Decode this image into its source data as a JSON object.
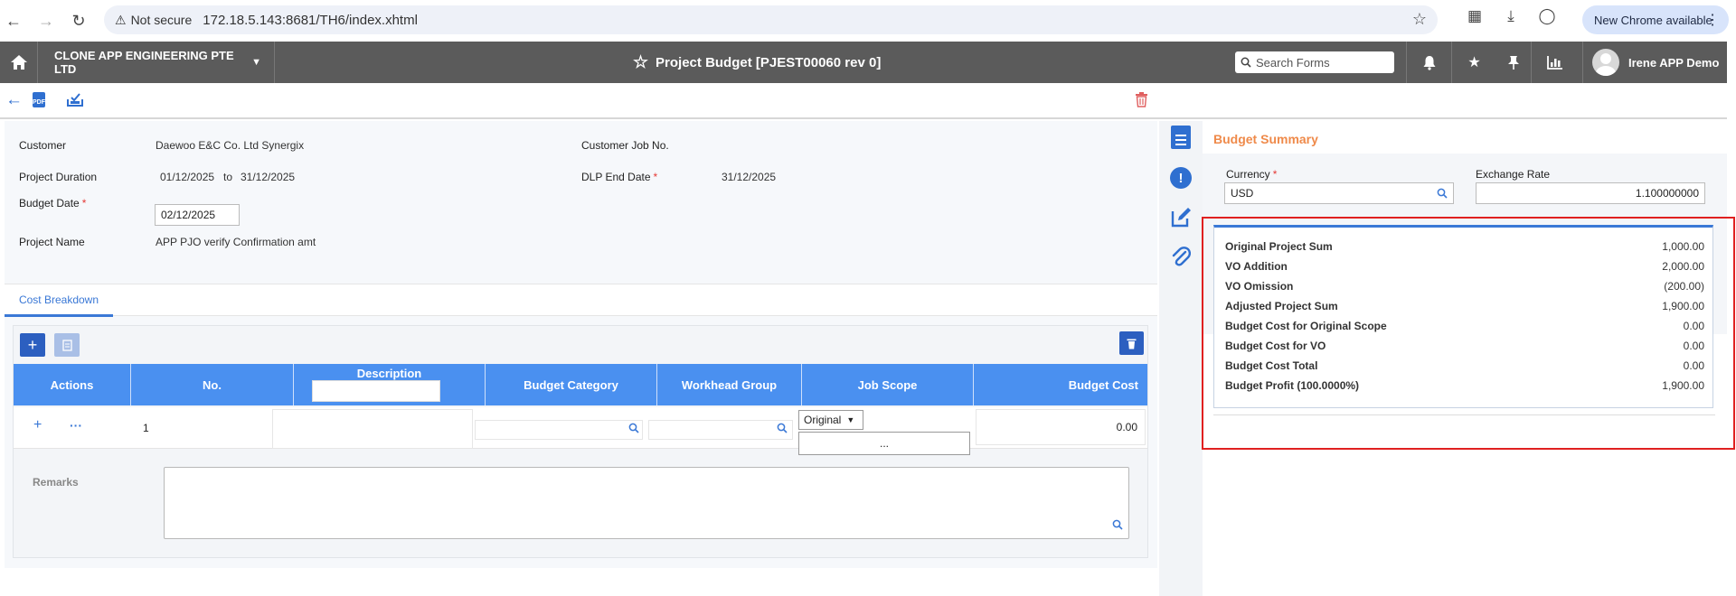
{
  "browser": {
    "security_label": "Not secure",
    "url": "172.18.5.143:8681/TH6/index.xhtml",
    "update_label": "New Chrome available"
  },
  "header": {
    "company": "CLONE APP ENGINEERING PTE LTD",
    "title": "Project Budget [PJEST00060 rev 0]",
    "search_placeholder": "Search Forms",
    "user_name": "Irene APP Demo"
  },
  "form": {
    "customer_label": "Customer",
    "customer_value": "Daewoo E&C Co. Ltd Synergix",
    "customer_job_label": "Customer Job No.",
    "duration_label": "Project Duration",
    "duration_from": "01/12/2025",
    "duration_to_word": "to",
    "duration_to": "31/12/2025",
    "dlp_label": "DLP End Date",
    "dlp_value": "31/12/2025",
    "budget_date_label": "Budget Date",
    "budget_date_value": "02/12/2025",
    "project_name_label": "Project Name",
    "project_name_value": "APP PJO verify Confirmation amt",
    "required_mark": "*"
  },
  "tabs": {
    "cost_breakdown": "Cost Breakdown"
  },
  "grid": {
    "columns": [
      "Actions",
      "No.",
      "Description",
      "Budget Category",
      "Workhead Group",
      "Job Scope",
      "Budget Cost"
    ],
    "row": {
      "add": "+",
      "more": "···",
      "no": "1",
      "job_scope_select": "Original",
      "ellipsis": "...",
      "budget_cost": "0.00"
    },
    "remarks_label": "Remarks"
  },
  "summary": {
    "title": "Budget Summary",
    "currency_label": "Currency",
    "currency_value": "USD",
    "exchange_label": "Exchange Rate",
    "exchange_value": "1.100000000",
    "rows": [
      {
        "label": "Original Project Sum",
        "value": "1,000.00"
      },
      {
        "label": "VO Addition",
        "value": "2,000.00"
      },
      {
        "label": "VO Omission",
        "value": "(200.00)"
      },
      {
        "label": "Adjusted Project Sum",
        "value": "1,900.00"
      },
      {
        "label": "Budget Cost for Original Scope",
        "value": "0.00"
      },
      {
        "label": "Budget Cost for VO",
        "value": "0.00"
      },
      {
        "label": "Budget Cost Total",
        "value": "0.00"
      },
      {
        "label": "Budget Profit (100.0000%)",
        "value": "1,900.00"
      }
    ]
  },
  "colors": {
    "header_bg": "#5b5b5b",
    "accent_blue": "#3a78d6",
    "table_header": "#4a90f0",
    "summary_title": "#ef8a4a",
    "highlight_border": "#e02020"
  }
}
